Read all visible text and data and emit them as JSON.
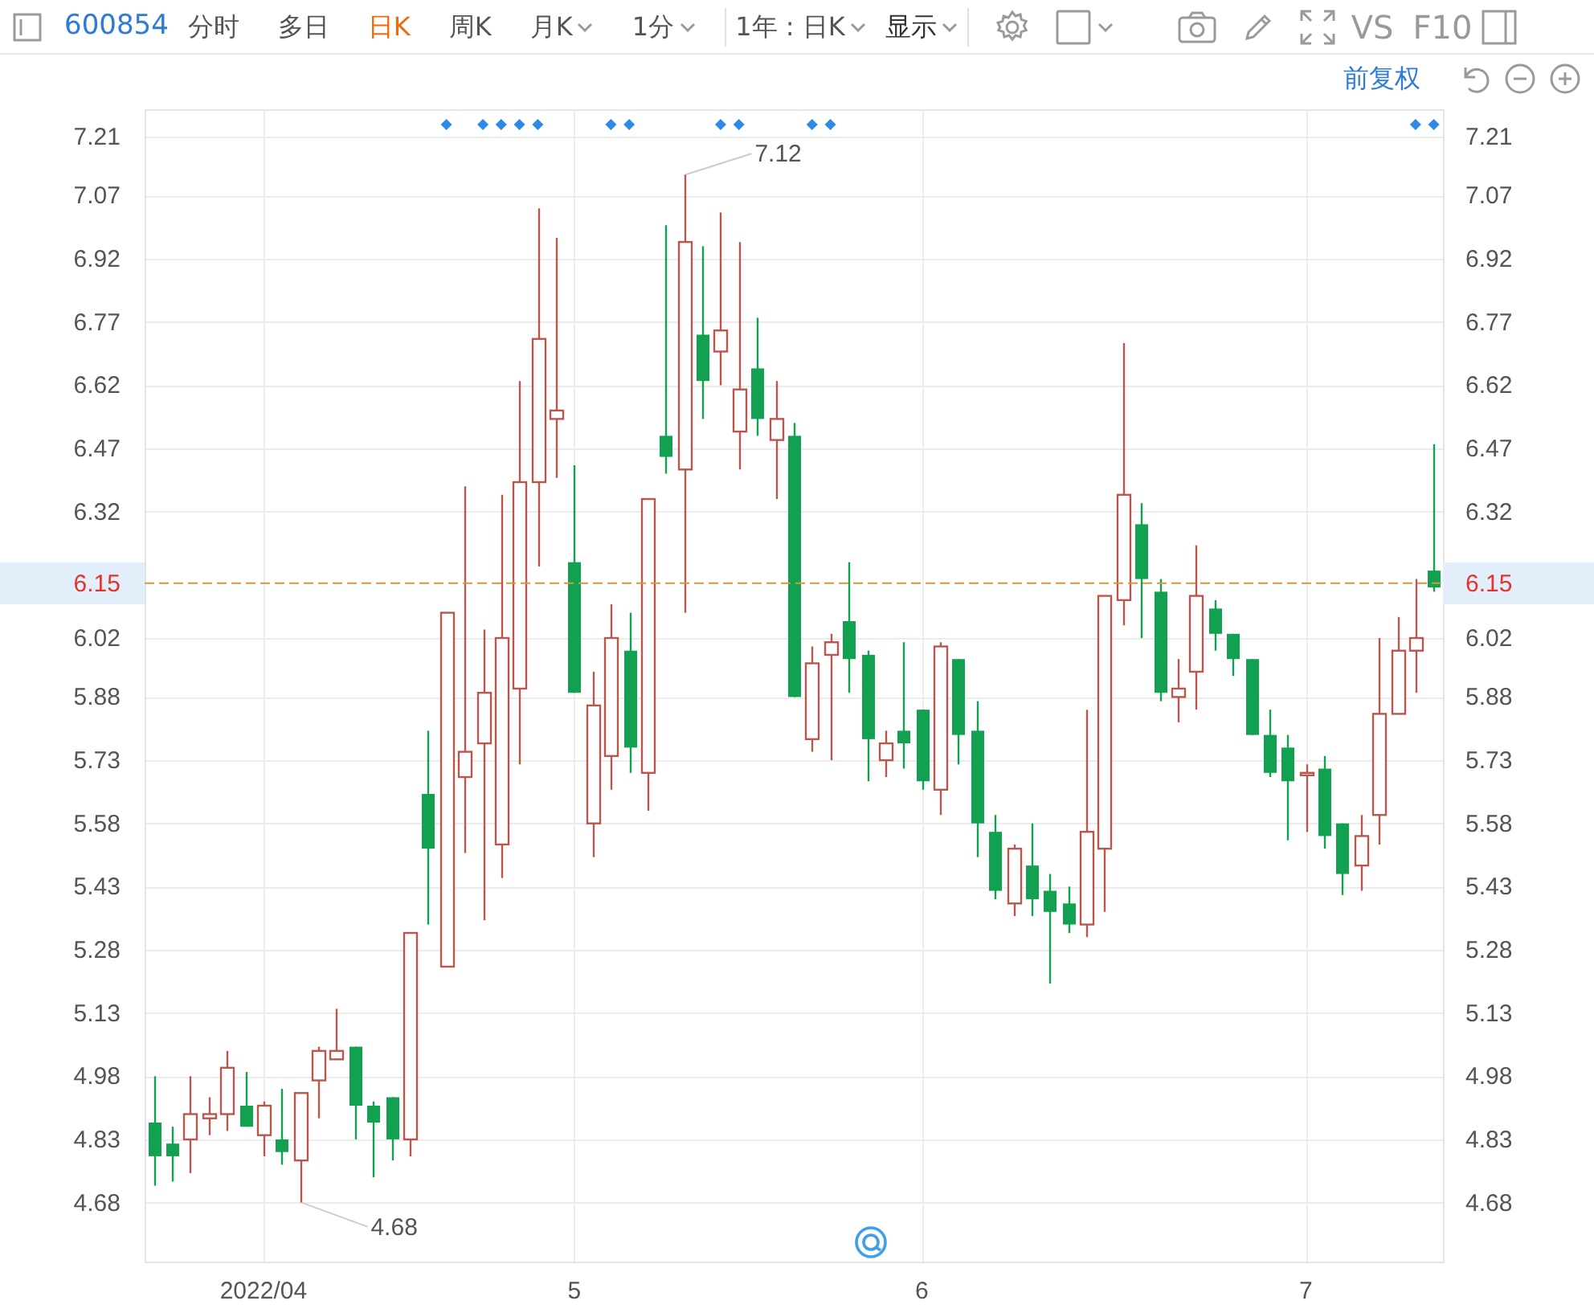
{
  "toolbar": {
    "code": "600854",
    "tabs": [
      {
        "label": "分时",
        "selected": false,
        "has_menu": false
      },
      {
        "label": "多日",
        "selected": false,
        "has_menu": false
      },
      {
        "label": "日K",
        "selected": true,
        "has_menu": false
      },
      {
        "label": "周K",
        "selected": false,
        "has_menu": false
      },
      {
        "label": "月K",
        "selected": false,
        "has_menu": true
      },
      {
        "label": "1分",
        "selected": false,
        "has_menu": true
      }
    ],
    "range": "1年 : 日K",
    "display": "显示",
    "compare": "VS",
    "f10": "F10"
  },
  "subbar": {
    "adjust": "前复权"
  },
  "chart": {
    "chart_data": {
      "type": "candlestick",
      "grid": true,
      "ylim": [
        4.54,
        7.275
      ],
      "yticks": [
        7.21,
        7.07,
        6.92,
        6.77,
        6.62,
        6.47,
        6.32,
        6.02,
        5.88,
        5.73,
        5.58,
        5.43,
        5.28,
        5.13,
        4.98,
        4.83,
        4.68
      ],
      "categories": [
        null,
        null,
        null,
        null,
        null,
        null,
        "2022/04",
        null,
        null,
        null,
        null,
        null,
        null,
        null,
        null,
        null,
        null,
        null,
        null,
        null,
        null,
        null,
        null,
        "5",
        null,
        null,
        null,
        null,
        null,
        null,
        null,
        null,
        null,
        null,
        null,
        null,
        null,
        null,
        null,
        null,
        null,
        null,
        "6",
        null,
        null,
        null,
        null,
        null,
        null,
        null,
        null,
        null,
        null,
        null,
        null,
        null,
        null,
        null,
        null,
        null,
        null,
        null,
        null,
        "7",
        null,
        null,
        null,
        null,
        null,
        null,
        null
      ],
      "ohlc": [
        [
          4.87,
          4.98,
          4.72,
          4.79
        ],
        [
          4.82,
          4.86,
          4.73,
          4.79
        ],
        [
          4.83,
          4.98,
          4.75,
          4.89
        ],
        [
          4.88,
          4.93,
          4.84,
          4.89
        ],
        [
          4.89,
          5.04,
          4.85,
          5.0
        ],
        [
          4.91,
          4.99,
          4.86,
          4.86
        ],
        [
          4.84,
          4.92,
          4.79,
          4.91
        ],
        [
          4.83,
          4.95,
          4.77,
          4.8
        ],
        [
          4.78,
          4.94,
          4.68,
          4.94
        ],
        [
          4.97,
          5.05,
          4.88,
          5.04
        ],
        [
          5.02,
          5.14,
          5.02,
          5.04
        ],
        [
          5.05,
          5.05,
          4.83,
          4.91
        ],
        [
          4.91,
          4.92,
          4.74,
          4.87
        ],
        [
          4.93,
          4.93,
          4.78,
          4.83
        ],
        [
          4.83,
          5.32,
          4.79,
          5.32
        ],
        [
          5.65,
          5.8,
          5.34,
          5.52
        ],
        [
          5.24,
          6.08,
          5.24,
          6.08
        ],
        [
          5.69,
          6.38,
          5.51,
          5.75
        ],
        [
          5.77,
          6.04,
          5.35,
          5.89
        ],
        [
          5.53,
          6.36,
          5.45,
          6.02
        ],
        [
          5.9,
          6.63,
          5.72,
          6.39
        ],
        [
          6.39,
          7.04,
          6.19,
          6.73
        ],
        [
          6.54,
          6.97,
          6.4,
          6.56
        ],
        [
          6.2,
          6.43,
          5.89,
          5.89
        ],
        [
          5.58,
          5.94,
          5.5,
          5.86
        ],
        [
          5.74,
          6.1,
          5.66,
          6.02
        ],
        [
          5.99,
          6.08,
          5.7,
          5.76
        ],
        [
          5.7,
          6.35,
          5.61,
          6.35
        ],
        [
          6.5,
          7.0,
          6.41,
          6.45
        ],
        [
          6.42,
          7.12,
          6.08,
          6.96
        ],
        [
          6.74,
          6.95,
          6.54,
          6.63
        ],
        [
          6.7,
          7.03,
          6.62,
          6.75
        ],
        [
          6.51,
          6.96,
          6.42,
          6.61
        ],
        [
          6.66,
          6.78,
          6.5,
          6.54
        ],
        [
          6.49,
          6.63,
          6.35,
          6.54
        ],
        [
          6.5,
          6.53,
          5.88,
          5.88
        ],
        [
          5.78,
          6.0,
          5.75,
          5.96
        ],
        [
          5.98,
          6.03,
          5.73,
          6.01
        ],
        [
          6.06,
          6.2,
          5.89,
          5.97
        ],
        [
          5.98,
          5.99,
          5.68,
          5.78
        ],
        [
          5.73,
          5.8,
          5.69,
          5.77
        ],
        [
          5.8,
          6.01,
          5.71,
          5.77
        ],
        [
          5.85,
          5.85,
          5.66,
          5.68
        ],
        [
          5.66,
          6.01,
          5.6,
          6.0
        ],
        [
          5.97,
          5.97,
          5.72,
          5.79
        ],
        [
          5.8,
          5.87,
          5.5,
          5.58
        ],
        [
          5.56,
          5.6,
          5.4,
          5.42
        ],
        [
          5.39,
          5.53,
          5.36,
          5.52
        ],
        [
          5.48,
          5.58,
          5.36,
          5.4
        ],
        [
          5.42,
          5.46,
          5.2,
          5.37
        ],
        [
          5.39,
          5.43,
          5.32,
          5.34
        ],
        [
          5.34,
          5.85,
          5.31,
          5.56
        ],
        [
          5.52,
          6.12,
          5.37,
          6.12
        ],
        [
          6.11,
          6.72,
          6.05,
          6.36
        ],
        [
          6.29,
          6.34,
          6.02,
          6.16
        ],
        [
          6.13,
          6.16,
          5.87,
          5.89
        ],
        [
          5.88,
          5.97,
          5.82,
          5.9
        ],
        [
          5.94,
          6.24,
          5.85,
          6.12
        ],
        [
          6.09,
          6.11,
          5.99,
          6.03
        ],
        [
          6.03,
          6.03,
          5.93,
          5.97
        ],
        [
          5.97,
          5.97,
          5.79,
          5.79
        ],
        [
          5.79,
          5.85,
          5.69,
          5.7
        ],
        [
          5.76,
          5.79,
          5.54,
          5.68
        ],
        [
          5.7,
          5.72,
          5.56,
          5.7
        ],
        [
          5.71,
          5.74,
          5.52,
          5.55
        ],
        [
          5.58,
          5.58,
          5.41,
          5.46
        ],
        [
          5.48,
          5.6,
          5.42,
          5.55
        ],
        [
          5.6,
          6.02,
          5.53,
          5.84
        ],
        [
          5.84,
          6.07,
          5.84,
          5.99
        ],
        [
          5.99,
          6.16,
          5.89,
          6.02
        ],
        [
          6.18,
          6.48,
          6.13,
          6.14
        ]
      ],
      "ref_lines": [
        {
          "axis": "y",
          "value": 6.15,
          "label": "6.15"
        }
      ],
      "annotations": [
        "7.12",
        "4.68"
      ]
    },
    "left_axis": {
      "labels": [
        "7.21",
        "7.07",
        "6.92",
        "6.77",
        "6.62",
        "6.47",
        "6.32",
        "6.02",
        "5.88",
        "5.73",
        "5.58",
        "5.43",
        "5.28",
        "5.13",
        "4.98",
        "4.83",
        "4.68"
      ]
    },
    "right_axis": {
      "labels": [
        "7.21",
        "7.07",
        "6.92",
        "6.77",
        "6.62",
        "6.47",
        "6.32",
        "6.02",
        "5.88",
        "5.73",
        "5.58",
        "5.43",
        "5.28",
        "5.13",
        "4.98",
        "4.83",
        "4.68"
      ],
      "price_label": "6.15"
    },
    "event_markers": [
      false,
      false,
      false,
      false,
      false,
      false,
      false,
      false,
      false,
      false,
      false,
      false,
      false,
      false,
      false,
      false,
      true,
      false,
      true,
      true,
      true,
      true,
      false,
      false,
      false,
      true,
      true,
      false,
      false,
      false,
      false,
      true,
      true,
      false,
      false,
      false,
      true,
      true,
      false,
      false,
      false,
      false,
      false,
      false,
      false,
      false,
      false,
      false,
      false,
      false,
      false,
      false,
      false,
      false,
      false,
      false,
      false,
      false,
      false,
      false,
      false,
      false,
      false,
      false,
      false,
      false,
      false,
      false,
      false,
      true,
      true
    ]
  }
}
